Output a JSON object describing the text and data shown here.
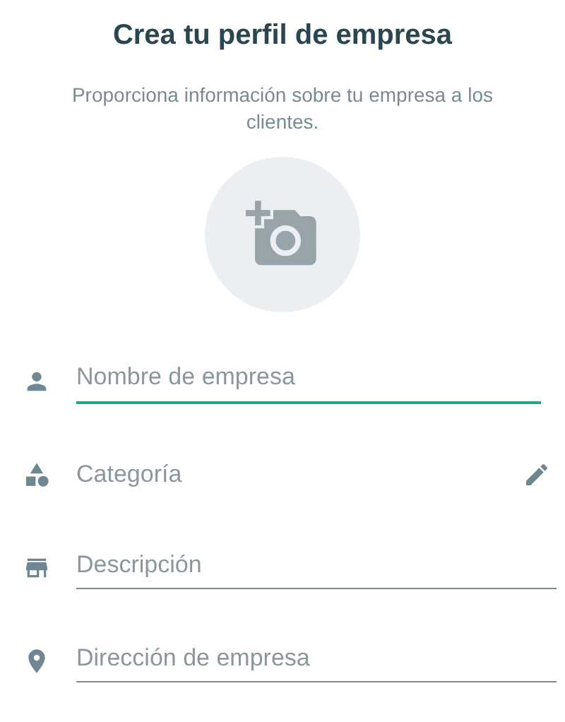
{
  "title": "Crea tu perfil de empresa",
  "subtitle": "Proporciona información sobre tu empresa a los clientes.",
  "fields": [
    {
      "kind": "input",
      "placeholder": "Nombre de empresa",
      "focused": true
    },
    {
      "kind": "select",
      "label": "Categoría"
    },
    {
      "kind": "input",
      "placeholder": "Descripción",
      "focused": false
    },
    {
      "kind": "input",
      "placeholder": "Dirección de empresa",
      "focused": false
    }
  ]
}
